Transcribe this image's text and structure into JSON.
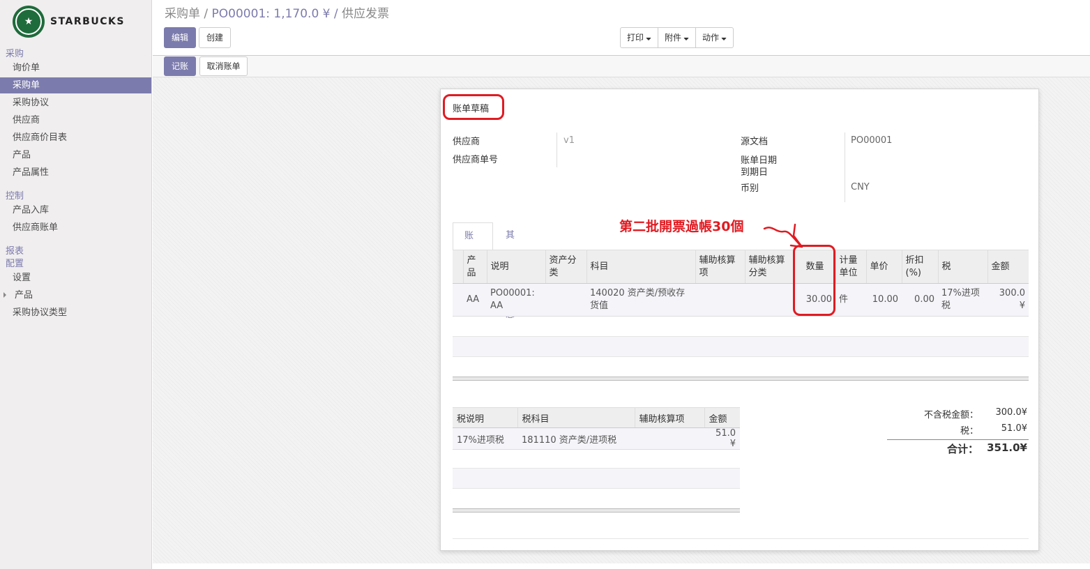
{
  "brand": {
    "name": "STARBUCKS",
    "color": "#1e6b3b"
  },
  "accent_color": "#7c7bad",
  "annotation_color": "#e01b22",
  "sidebar": {
    "sections": [
      {
        "label": "采购"
      },
      {
        "label": "控制"
      },
      {
        "label": "报表"
      },
      {
        "label": "配置"
      }
    ],
    "purchase_items": [
      "询价单",
      "采购单",
      "采购协议",
      "供应商",
      "供应商价目表",
      "产品",
      "产品属性"
    ],
    "control_items": [
      "产品入库",
      "供应商账单"
    ],
    "config_items": [
      "设置",
      "产品",
      "采购协议类型"
    ]
  },
  "breadcrumb": {
    "root": "采购单 /",
    "order": "PO00001: 1,170.0 ¥ /",
    "current": "供应发票"
  },
  "toolbar": {
    "edit": "编辑",
    "create": "创建",
    "print": "打印",
    "attachment": "附件",
    "action": "动作"
  },
  "statusbar": {
    "post": "记账",
    "cancel": "取消账单"
  },
  "invoice": {
    "title": "账单草稿",
    "vendor_label": "供应商",
    "vendor_value": "v1",
    "vendor_ref_label": "供应商单号",
    "source_label": "源文档",
    "source_value": "PO00001",
    "bill_date_label": "账单日期",
    "due_date_label": "到期日",
    "currency_label": "币别",
    "currency_value": "CNY"
  },
  "tabs": [
    "账单",
    "其它信息"
  ],
  "annotation": "第二批開票過帳30個",
  "lines": {
    "headers": [
      "产品",
      "说明",
      "资产分类",
      "科目",
      "辅助核算项",
      "辅助核算分类",
      "数量",
      "计量单位",
      "单价",
      "折扣 (%)",
      "税",
      "金额"
    ],
    "rows": [
      {
        "product": "AA",
        "description": "PO00001: AA",
        "asset_category": "",
        "account": "140020 资产类/预收存货值",
        "analytic": "",
        "analytic_tags": "",
        "quantity": "30.00",
        "uom": "件",
        "price": "10.00",
        "discount": "0.00",
        "tax": "17%进项税",
        "amount": "300.0 ¥"
      }
    ]
  },
  "taxes": {
    "headers": [
      "税说明",
      "税科目",
      "辅助核算项",
      "金额"
    ],
    "rows": [
      {
        "description": "17%进项税",
        "account": "181110 资产类/进项税",
        "analytic": "",
        "amount": "51.0 ¥"
      }
    ]
  },
  "totals": {
    "untaxed_label": "不含税金额：",
    "untaxed_value": "300.0¥",
    "tax_label": "税：",
    "tax_value": "51.0¥",
    "total_label": "合计：",
    "total_value": "351.0¥"
  }
}
